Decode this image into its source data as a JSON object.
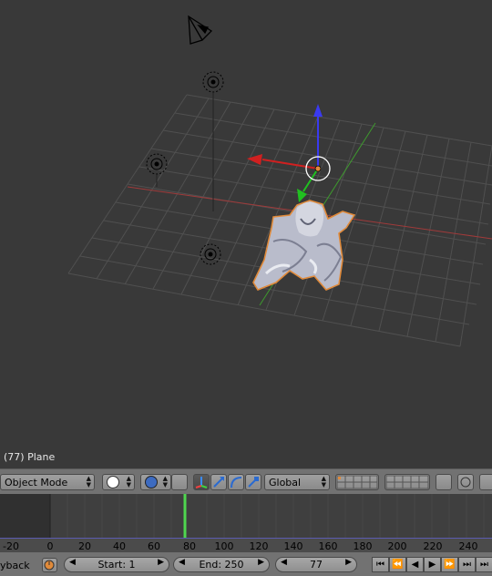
{
  "viewport": {
    "object_label": "(77) Plane"
  },
  "header": {
    "mode_label": "Object Mode",
    "orientation_label": "Global"
  },
  "timeline": {
    "ruler_ticks": [
      "-20",
      "0",
      "20",
      "40",
      "60",
      "80",
      "100",
      "120",
      "140",
      "160",
      "180",
      "200",
      "220",
      "240"
    ],
    "current_frame_fraction": 0.385
  },
  "footer": {
    "playback_label": "yback",
    "start_label": "Start: 1",
    "end_label": "End: 250",
    "current_frame": "77"
  },
  "colors": {
    "viewport_bg": "#393939",
    "grid": "#505050",
    "x_axis": "#a03a3a",
    "y_axis": "#3e9a2e",
    "selection_outline": "#e08a3a",
    "playhead": "#4fd64f"
  },
  "icons": {
    "camera": "camera-icon",
    "lamp": "lamp-icon",
    "manipulator": "transform-manipulator-icon",
    "shading": "viewport-shading-icon",
    "pivot": "pivot-point-icon"
  }
}
